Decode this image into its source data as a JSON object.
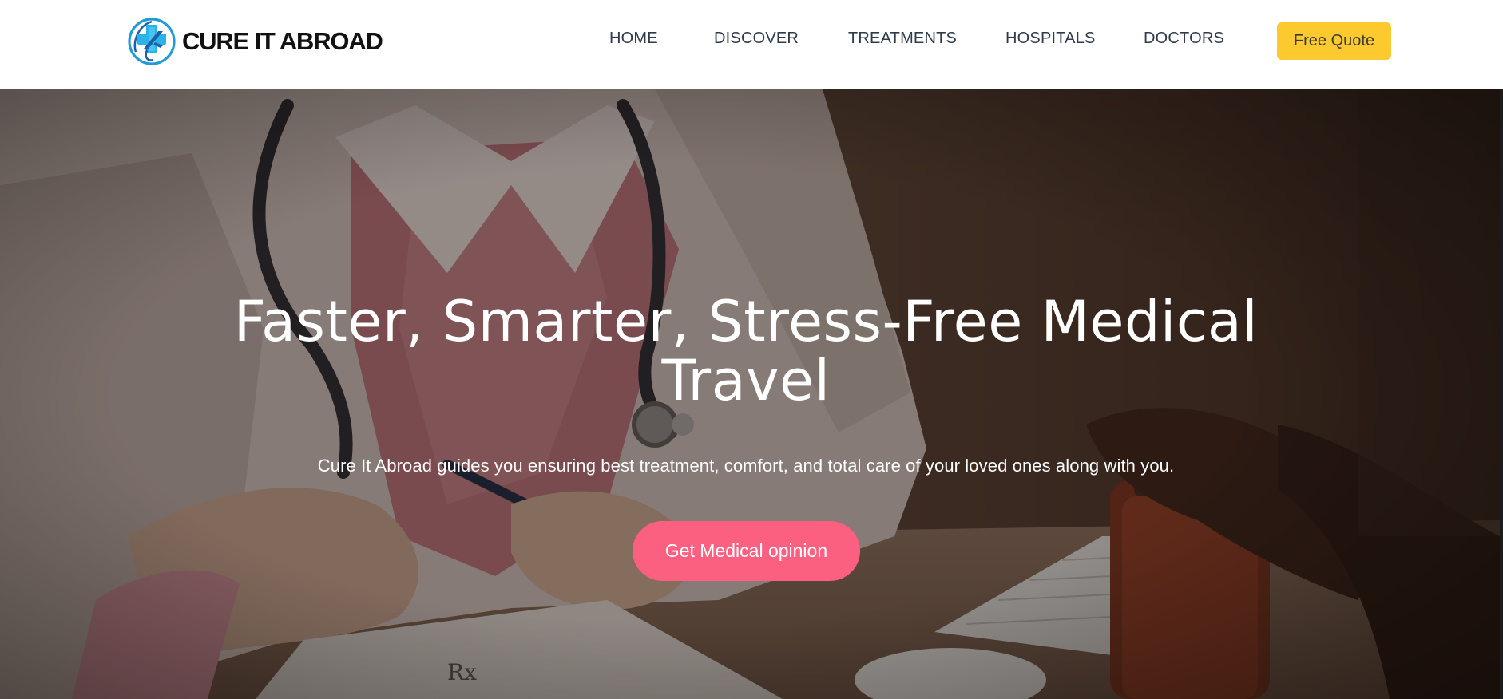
{
  "brand": {
    "name": "CURE IT ABROAD",
    "logo_icon": "medical-cross-plane-icon",
    "colors": {
      "logo_ring": "#1f9bd6",
      "logo_cross": "#29b3e8",
      "logo_plane": "#1f5fa8"
    }
  },
  "nav": {
    "items": [
      {
        "label": "HOME"
      },
      {
        "label": "DISCOVER"
      },
      {
        "label": "TREATMENTS"
      },
      {
        "label": "HOSPITALS"
      },
      {
        "label": "DOCTORS"
      }
    ],
    "cta_label": "Free Quote",
    "cta_color": "#fcc92e"
  },
  "hero": {
    "title_line1": "Faster, Smarter, Stress-Free Medical",
    "title_line2": "Travel",
    "subtitle": "Cure It Abroad guides you ensuring best treatment, comfort, and total care of your loved ones along with you.",
    "cta_label": "Get Medical opinion",
    "cta_color": "#fb6080",
    "background_image": "doctor-consultation-photo"
  }
}
